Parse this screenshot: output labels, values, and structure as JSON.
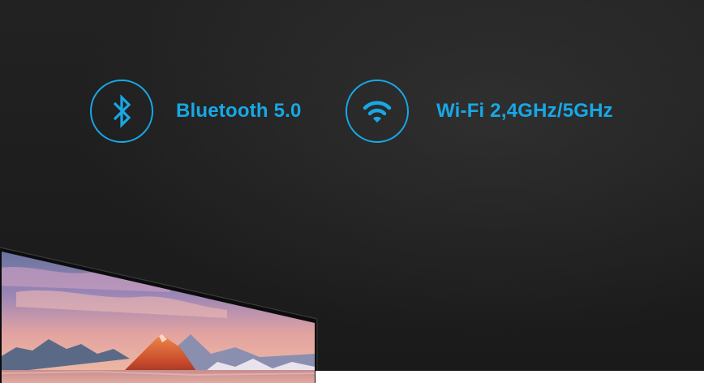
{
  "features": [
    {
      "label": "Bluetooth 5.0",
      "icon": "bluetooth-icon"
    },
    {
      "label": "Wi-Fi 2,4GHz/5GHz",
      "icon": "wifi-icon"
    }
  ],
  "colors": {
    "accent": "#17a8e6",
    "background": "#1b1b1b"
  }
}
